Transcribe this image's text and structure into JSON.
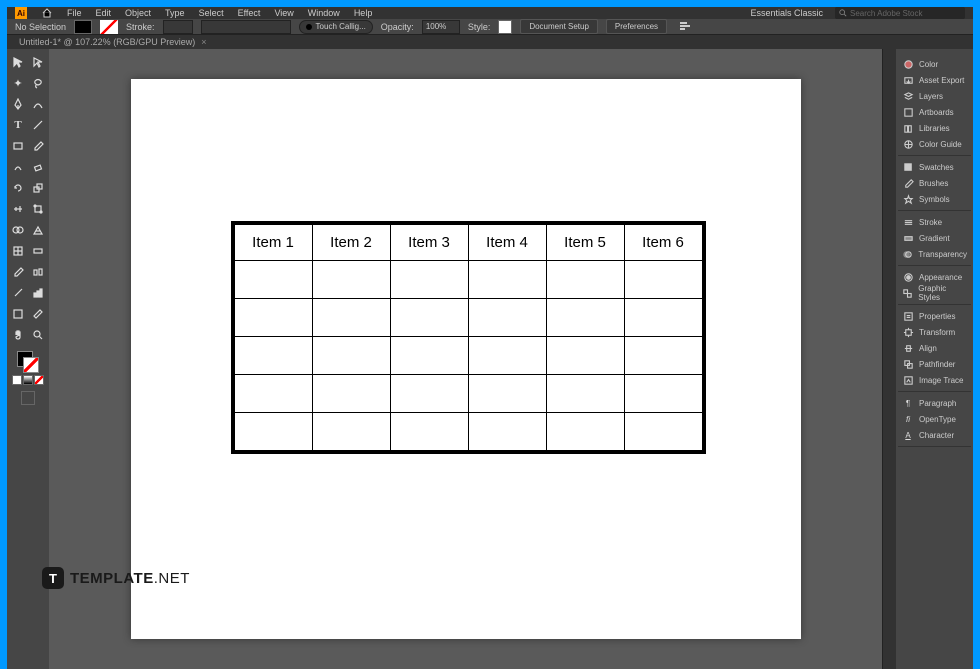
{
  "menubar": {
    "items": [
      "File",
      "Edit",
      "Object",
      "Type",
      "Select",
      "Effect",
      "View",
      "Window",
      "Help"
    ],
    "workspace": "Essentials Classic",
    "search_placeholder": "Search Adobe Stock"
  },
  "controlbar": {
    "selection": "No Selection",
    "stroke_label": "Stroke:",
    "brush": "Touch Callig...",
    "opacity_label": "Opacity:",
    "opacity_value": "100%",
    "style_label": "Style:",
    "doc_setup": "Document Setup",
    "prefs": "Preferences"
  },
  "tab": {
    "title": "Untitled-1* @ 107.22% (RGB/GPU Preview)"
  },
  "table": {
    "headers": [
      "Item 1",
      "Item 2",
      "Item 3",
      "Item 4",
      "Item 5",
      "Item 6"
    ],
    "rows": 5
  },
  "panels": {
    "g1": [
      "Color",
      "Asset Export",
      "Layers",
      "Artboards",
      "Libraries",
      "Color Guide"
    ],
    "g2": [
      "Swatches",
      "Brushes",
      "Symbols"
    ],
    "g3": [
      "Stroke",
      "Gradient",
      "Transparency"
    ],
    "g4": [
      "Appearance",
      "Graphic Styles"
    ],
    "g5": [
      "Properties",
      "Transform",
      "Align",
      "Pathfinder",
      "Image Trace"
    ],
    "g6": [
      "Paragraph",
      "OpenType",
      "Character"
    ]
  },
  "watermark": {
    "badge": "T",
    "brand1": "TEMPLATE",
    "brand2": ".NET"
  }
}
